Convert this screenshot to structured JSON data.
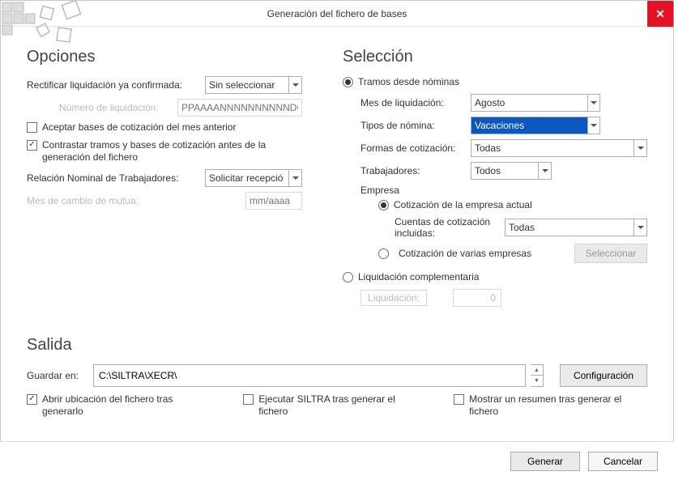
{
  "window": {
    "title": "Generación del fichero de bases"
  },
  "opciones": {
    "heading": "Opciones",
    "rectificar_label": "Rectificar liquidación ya confirmada:",
    "rectificar_value": "Sin seleccionar",
    "numero_liquidacion_label": "Número de liquidación:",
    "numero_liquidacion_placeholder": "PPAAAANNNNNNNNNNDC",
    "aceptar_bases": "Aceptar bases de cotización del mes anterior",
    "contrastar_tramos": "Contrastar tramos y bases de cotización antes de la generación del fichero",
    "relacion_nominal_label": "Relación Nominal de Trabajadores:",
    "relacion_nominal_value": "Solicitar recepció",
    "mes_cambio_mutua_label": "Mes de cambio de mutua:",
    "mes_cambio_mutua_placeholder": "mm/aaaa"
  },
  "seleccion": {
    "heading": "Selección",
    "tramos_radio": "Tramos desde nóminas",
    "mes_liquidacion_label": "Mes de liquidación:",
    "mes_liquidacion_value": "Agosto",
    "tipos_nomina_label": "Tipos de nómina:",
    "tipos_nomina_value": "Vacaciones",
    "formas_cotizacion_label": "Formas de cotización:",
    "formas_cotizacion_value": "Todas",
    "trabajadores_label": "Trabajadores:",
    "trabajadores_value": "Todos",
    "empresa_label": "Empresa",
    "cotizacion_actual": "Cotización de la empresa actual",
    "cuentas_incluidas_label": "Cuentas de cotización incluidas:",
    "cuentas_incluidas_value": "Todas",
    "cotizacion_varias": "Cotización de varias empresas",
    "seleccionar_btn": "Seleccionar",
    "liquidacion_comp_radio": "Liquidación complementaria",
    "liquidacion_label": "Liquidación:",
    "liquidacion_value": "0"
  },
  "salida": {
    "heading": "Salida",
    "guardar_en_label": "Guardar en:",
    "path_value": "C:\\SILTRA\\XECR\\",
    "configuracion_btn": "Configuración",
    "abrir_ubicacion": "Abrir ubicación del fichero tras generarlo",
    "ejecutar_siltra": "Ejecutar SILTRA tras generar el fichero",
    "mostrar_resumen": "Mostrar un resumen tras generar el fichero"
  },
  "footer": {
    "generar": "Generar",
    "cancelar": "Cancelar"
  }
}
